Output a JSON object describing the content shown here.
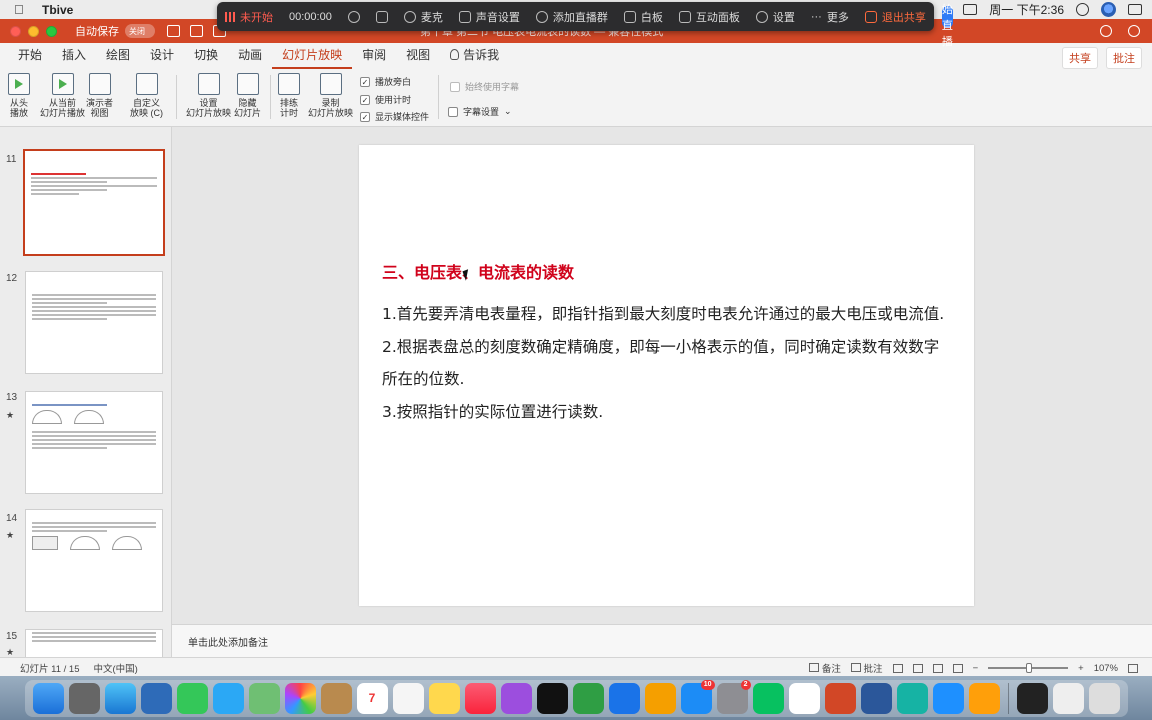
{
  "menubar": {
    "app_name": "Tbive",
    "clock": "周一 下午2:36"
  },
  "recorder": {
    "status": "未开始",
    "time": "00:00:00",
    "items": [
      "麦克",
      "声音设置",
      "添加直播群",
      "白板",
      "互动面板",
      "设置",
      "更多"
    ],
    "share_label": "退出共享",
    "start_label": "开始直播"
  },
  "titlebar": {
    "autosave_label": "自动保存",
    "autosave_state": "关闭",
    "document_title": "第十章 第二节 电压表电流表的读数 — 兼容性模式"
  },
  "tabs": [
    "开始",
    "插入",
    "绘图",
    "设计",
    "切换",
    "动画",
    "幻灯片放映",
    "审阅",
    "视图",
    "告诉我"
  ],
  "active_tab": "幻灯片放映",
  "tab_actions": {
    "share": "共享",
    "comment": "批注"
  },
  "ribbon": {
    "buttons": [
      {
        "id": "from-start",
        "label1": "从头",
        "label2": "播放"
      },
      {
        "id": "from-current",
        "label1": "从当前",
        "label2": "幻灯片播放"
      },
      {
        "id": "presenter",
        "label1": "演示者",
        "label2": "视图"
      },
      {
        "id": "custom",
        "label1": "自定义",
        "label2": "放映 (C)"
      },
      {
        "id": "setup",
        "label1": "设置",
        "label2": "幻灯片放映"
      },
      {
        "id": "hide",
        "label1": "隐藏",
        "label2": "幻灯片"
      },
      {
        "id": "rehearse",
        "label1": "排练",
        "label2": "计时"
      },
      {
        "id": "record",
        "label1": "录制",
        "label2": "幻灯片放映"
      }
    ],
    "checkboxes": [
      {
        "label": "播放旁白",
        "checked": true
      },
      {
        "label": "使用计时",
        "checked": true
      },
      {
        "label": "显示媒体控件",
        "checked": true
      }
    ],
    "subtitle_check": "始终使用字幕",
    "subtitle_settings": "字幕设置"
  },
  "thumbnails": [
    {
      "number": "11",
      "star": ""
    },
    {
      "number": "12",
      "star": ""
    },
    {
      "number": "13",
      "star": "★"
    },
    {
      "number": "14",
      "star": "★"
    },
    {
      "number": "15",
      "star": "★"
    }
  ],
  "slide": {
    "heading": "三、电压表、电流表的读数",
    "lines": [
      "1.首先要弄清电表量程，即指针指到最大刻度时电表允许通过的最大电压或电流值.",
      "2.根据表盘总的刻度数确定精确度，即每一小格表示的值，同时确定读数有效数字所在的位数.",
      "3.按照指针的实际位置进行读数."
    ]
  },
  "notes_placeholder": "单击此处添加备注",
  "status": {
    "slide_counter": "幻灯片 11 / 15",
    "language": "中文(中国)",
    "notes": "备注",
    "comments": "批注",
    "zoom": "107%"
  },
  "dock": {
    "badges": {
      "appstore": "10",
      "settings": "2"
    }
  }
}
